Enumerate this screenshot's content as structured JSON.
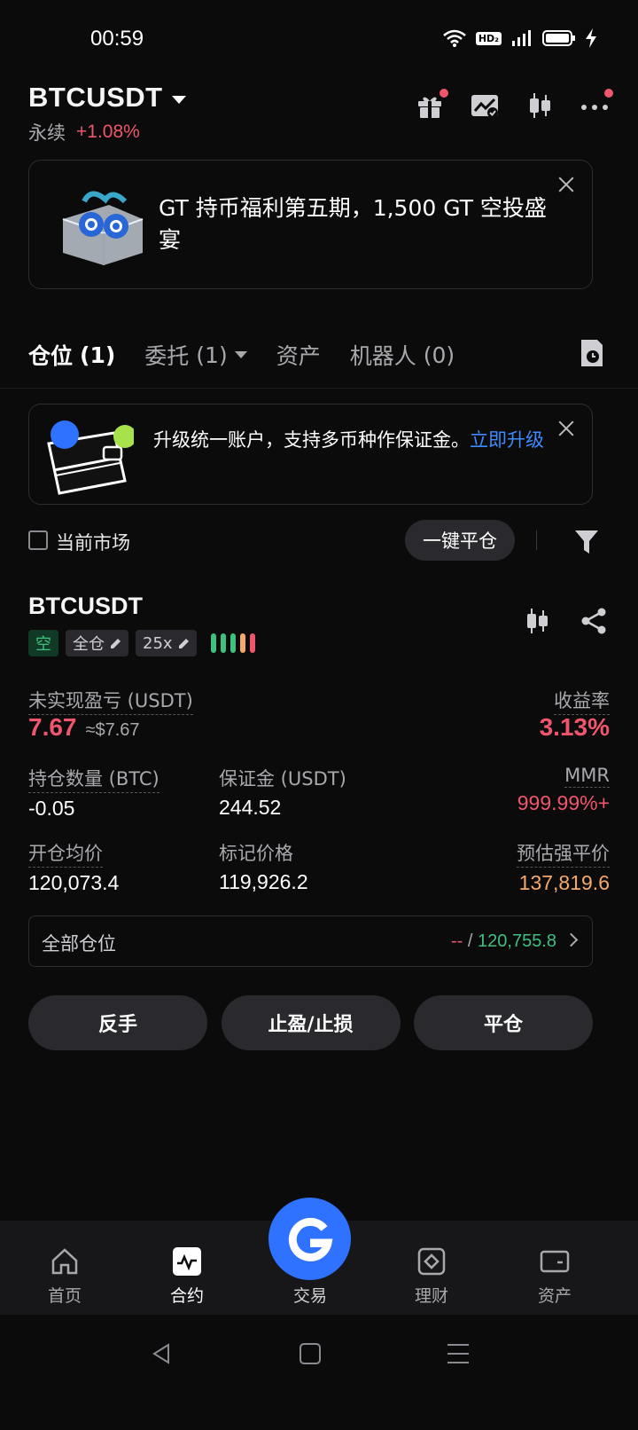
{
  "status_bar": {
    "time": "00:59",
    "hd_badge": "HD₂",
    "network": "4G"
  },
  "header": {
    "symbol": "BTCUSDT",
    "contract_type": "永续",
    "change_pct": "+1.08%"
  },
  "promo_banner": {
    "text": "GT 持币福利第五期，1,500 GT 空投盛宴"
  },
  "tabs": [
    {
      "label": "仓位",
      "count": "(1)"
    },
    {
      "label": "委托",
      "count": "(1)"
    },
    {
      "label": "资产",
      "count": ""
    },
    {
      "label": "机器人",
      "count": "(0)"
    }
  ],
  "upgrade_banner": {
    "text": "升级统一账户，支持多币种作保证金。",
    "link": "立即升级"
  },
  "filter": {
    "current_market_label": "当前市场",
    "close_all_label": "一键平仓"
  },
  "position": {
    "symbol": "BTCUSDT",
    "side": "空",
    "margin_mode": "全仓",
    "leverage": "25x",
    "unrealized_pnl_label": "未实现盈亏 (USDT)",
    "unrealized_pnl": "7.67",
    "unrealized_pnl_usd": "≈$7.67",
    "roe_label": "收益率",
    "roe": "3.13%",
    "size_label": "持仓数量 (BTC)",
    "size": "-0.05",
    "margin_label": "保证金 (USDT)",
    "margin": "244.52",
    "mmr_label": "MMR",
    "mmr": "999.99%+",
    "entry_label": "开仓均价",
    "entry": "120,073.4",
    "mark_label": "标记价格",
    "mark": "119,926.2",
    "liq_label": "预估强平价",
    "liq": "137,819.6",
    "all_positions_label": "全部仓位",
    "all_positions_left": "--",
    "all_positions_sep": " / ",
    "all_positions_right": "120,755.8"
  },
  "actions": {
    "reverse": "反手",
    "tp_sl": "止盈/止损",
    "close": "平仓"
  },
  "bottom_nav": [
    {
      "label": "首页",
      "icon": "home-icon"
    },
    {
      "label": "合约",
      "icon": "futures-icon"
    },
    {
      "label": "交易",
      "icon": "trade-icon"
    },
    {
      "label": "理财",
      "icon": "earn-icon"
    },
    {
      "label": "资产",
      "icon": "wallet-icon"
    }
  ],
  "colors": {
    "red": "#f0566b",
    "green": "#3fc07f",
    "blue": "#2f72ff",
    "liq_orange": "#f5a96b"
  }
}
